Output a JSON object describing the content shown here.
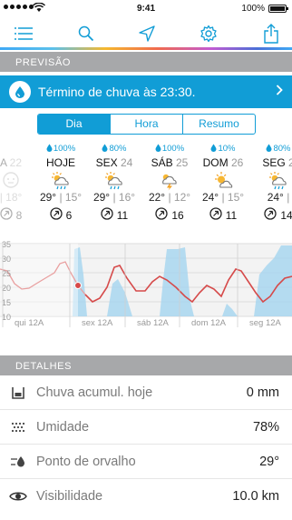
{
  "status_bar": {
    "time": "9:41",
    "battery": "100%"
  },
  "colors": {
    "accent": "#119dd6",
    "section_bg": "#a7a8aa",
    "temp_line": "#d64a4a",
    "rain_area": "#9fd3ef"
  },
  "sections": {
    "forecast": "PREVISÃO",
    "details": "DETALHES"
  },
  "banner": {
    "text": "Término de chuva às 23:30."
  },
  "tabs": [
    "Dia",
    "Hora",
    "Resumo"
  ],
  "days": [
    {
      "rain": "",
      "name": "A",
      "num": "22",
      "hi": "",
      "lo": "18°",
      "wind": "8",
      "icon": "cloudy-icon"
    },
    {
      "rain": "100%",
      "name": "HOJE",
      "num": "",
      "hi": "29°",
      "lo": "15°",
      "wind": "6",
      "icon": "rain-sun-icon"
    },
    {
      "rain": "80%",
      "name": "SEX",
      "num": "24",
      "hi": "29°",
      "lo": "16°",
      "wind": "11",
      "icon": "rain-sun-icon"
    },
    {
      "rain": "100%",
      "name": "SÁB",
      "num": "25",
      "hi": "22°",
      "lo": "12°",
      "wind": "16",
      "icon": "thunder-icon"
    },
    {
      "rain": "10%",
      "name": "DOM",
      "num": "26",
      "hi": "24°",
      "lo": "15°",
      "wind": "11",
      "icon": "sun-cloud-icon"
    },
    {
      "rain": "80%",
      "name": "SEG",
      "num": "2",
      "hi": "24°",
      "lo": "",
      "wind": "14",
      "icon": "rain-sun-icon"
    }
  ],
  "chart_data": {
    "type": "line",
    "y_ticks": [
      "35",
      "30",
      "25",
      "20",
      "15",
      "10"
    ],
    "x_labels": [
      "qui 12A",
      "sex 12A",
      "sáb 12A",
      "dom 12A",
      "seg 12A"
    ],
    "ylim": [
      10,
      35
    ]
  },
  "details": [
    {
      "label": "Chuva acumul. hoje",
      "value": "0 mm",
      "icon": "rain-gauge-icon"
    },
    {
      "label": "Umidade",
      "value": "78%",
      "icon": "humidity-icon"
    },
    {
      "label": "Ponto de orvalho",
      "value": "29°",
      "icon": "dew-point-icon"
    },
    {
      "label": "Visibilidade",
      "value": "10.0 km",
      "icon": "eye-icon"
    }
  ]
}
